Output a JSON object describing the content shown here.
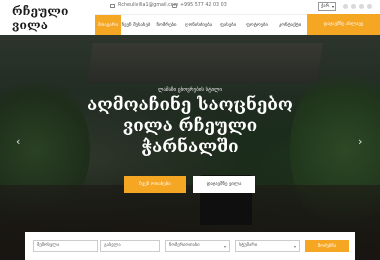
{
  "brand": {
    "logo_text": "რჩეული ვილა"
  },
  "topbar": {
    "email": "Rcheulivilla1@gmail.com",
    "phone": "+995 577 42 03 03",
    "language": "ქარ"
  },
  "nav": {
    "items": [
      {
        "label": "მთავარი",
        "active": true
      },
      {
        "label": "ჩვენ შესახებ",
        "active": false
      },
      {
        "label": "ნომრები",
        "active": false
      },
      {
        "label": "ღონისძიება",
        "active": false
      },
      {
        "label": "ფასები",
        "active": false
      },
      {
        "label": "ფოტოები",
        "active": false
      },
      {
        "label": "კონტაქტი",
        "active": false
      }
    ],
    "book_label": "დაჯავშნე ახლავე"
  },
  "hero": {
    "subtitle": "ლამაზი ცხოვრების სტილი",
    "title": "აღმოაჩინე საოცნებო ვილა რჩეული ჭარნალში",
    "primary_button": "ჩვენ ოთახები",
    "secondary_button": "დაჯავშნე ვილა",
    "prev_arrow": "‹",
    "next_arrow": "›"
  },
  "booking": {
    "checkin_placeholder": "შემოსვლა",
    "checkout_placeholder": "გასვლა",
    "rooms_value": "ნომერიოთახი",
    "guests_value": "სტუმარი",
    "submit_label": "მოძებნა"
  },
  "colors": {
    "accent": "#f5a623",
    "white": "#ffffff"
  }
}
